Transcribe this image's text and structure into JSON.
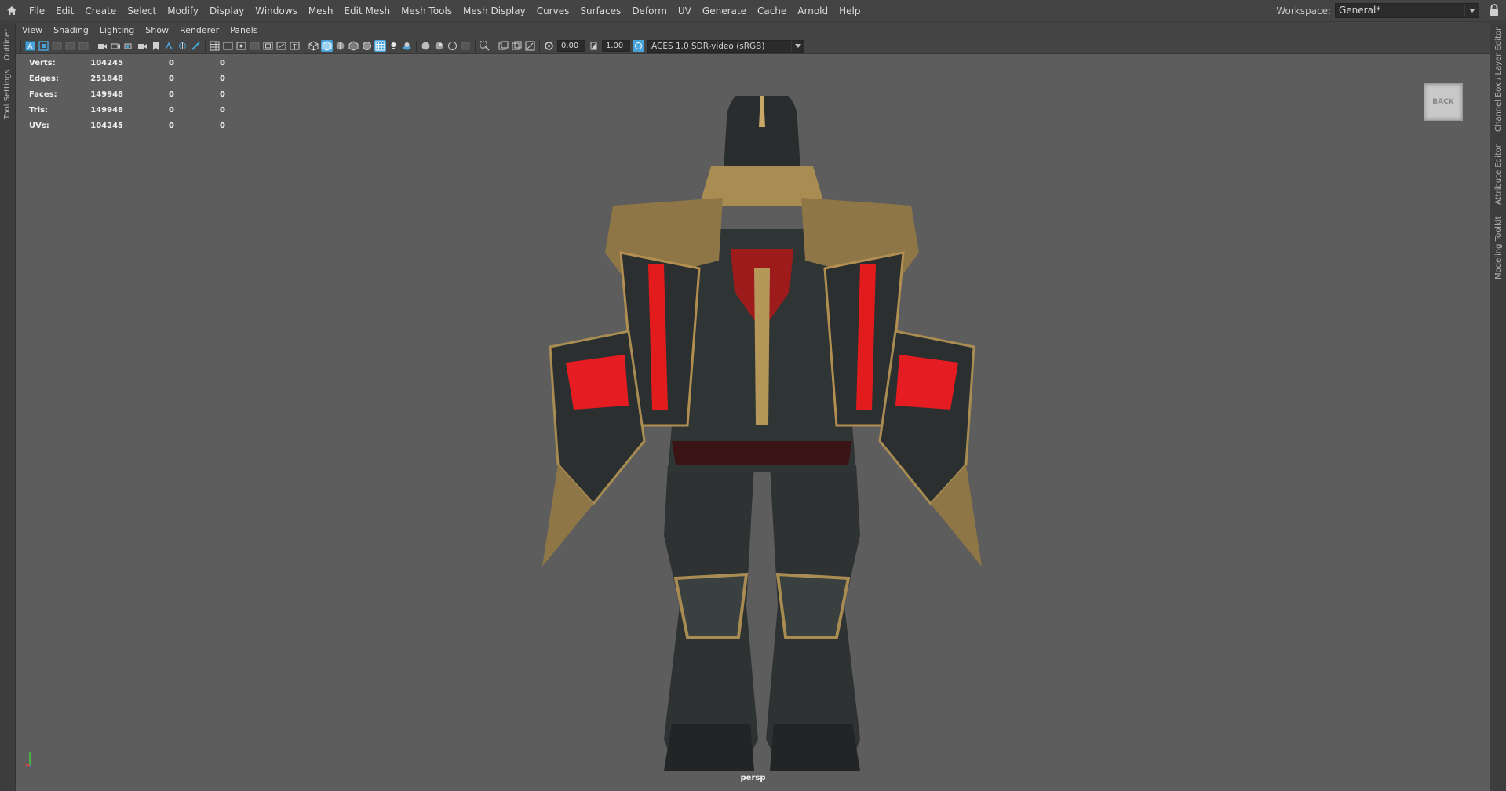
{
  "menubar": {
    "items": [
      "File",
      "Edit",
      "Create",
      "Select",
      "Modify",
      "Display",
      "Windows",
      "Mesh",
      "Edit Mesh",
      "Mesh Tools",
      "Mesh Display",
      "Curves",
      "Surfaces",
      "Deform",
      "UV",
      "Generate",
      "Cache",
      "Arnold",
      "Help"
    ],
    "workspace_label": "Workspace:",
    "workspace_value": "General*"
  },
  "left_tabs": [
    "Outliner",
    "Tool Settings"
  ],
  "right_tabs": [
    "Channel Box / Layer Editor",
    "Attribute Editor",
    "Modeling Toolkit"
  ],
  "panel": {
    "menus": [
      "View",
      "Shading",
      "Lighting",
      "Show",
      "Renderer",
      "Panels"
    ],
    "exposure": "0.00",
    "gamma": "1.00",
    "color_space": "ACES 1.0 SDR-video (sRGB)"
  },
  "hud": {
    "rows": [
      {
        "label": "Verts:",
        "v1": "104245",
        "v2": "0",
        "v3": "0"
      },
      {
        "label": "Edges:",
        "v1": "251848",
        "v2": "0",
        "v3": "0"
      },
      {
        "label": "Faces:",
        "v1": "149948",
        "v2": "0",
        "v3": "0"
      },
      {
        "label": "Tris:",
        "v1": "149948",
        "v2": "0",
        "v3": "0"
      },
      {
        "label": "UVs:",
        "v1": "104245",
        "v2": "0",
        "v3": "0"
      }
    ]
  },
  "viewport": {
    "view_cube_label": "BACK",
    "camera": "persp"
  },
  "colors": {
    "ui_bg": "#444444",
    "viewport_bg": "#5d5d5d",
    "highlight": "#4aa3d9"
  }
}
